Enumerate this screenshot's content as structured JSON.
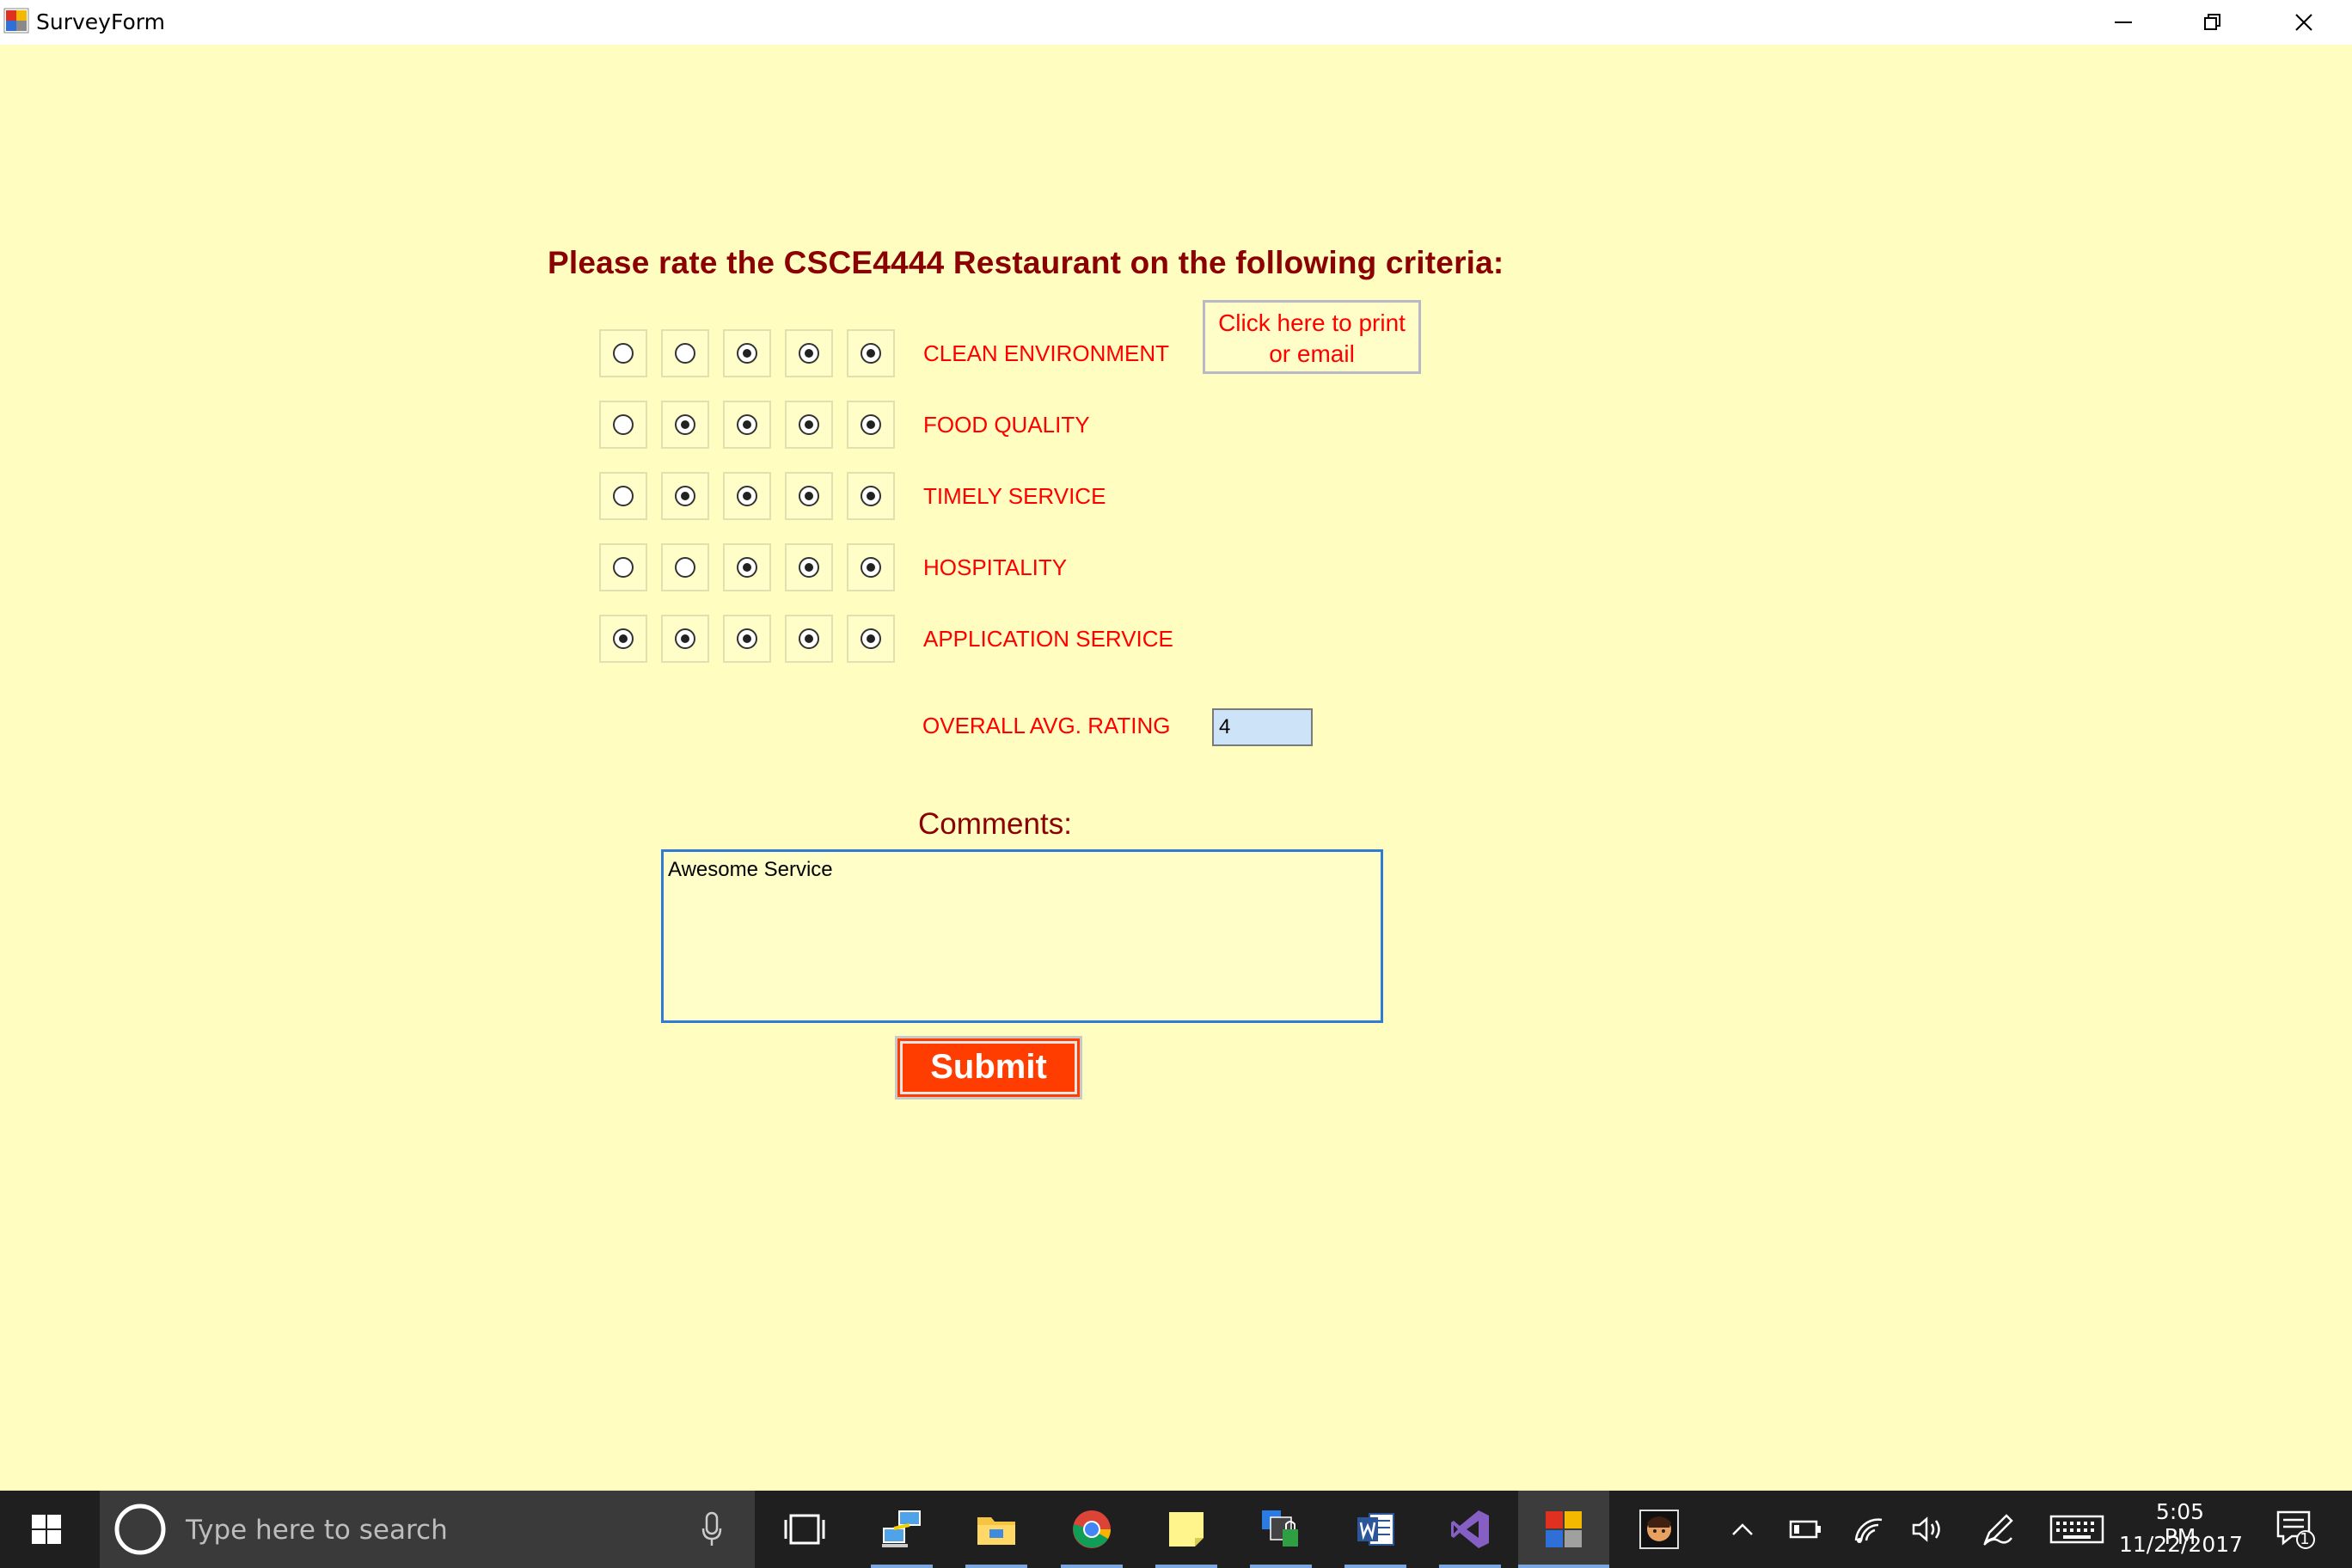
{
  "window": {
    "title": "SurveyForm",
    "icons": [
      "app-icon",
      "minimize-icon",
      "maximize-icon",
      "close-icon"
    ]
  },
  "form": {
    "heading": "Please rate the CSCE4444 Restaurant on the following criteria:",
    "print_button": "Click here to print or email",
    "criteria": [
      {
        "label": "CLEAN ENVIRONMENT",
        "rating": [
          false,
          false,
          true,
          true,
          true
        ]
      },
      {
        "label": "FOOD QUALITY",
        "rating": [
          false,
          true,
          true,
          true,
          true
        ]
      },
      {
        "label": "TIMELY SERVICE",
        "rating": [
          false,
          true,
          true,
          true,
          true
        ]
      },
      {
        "label": "HOSPITALITY",
        "rating": [
          false,
          false,
          true,
          true,
          true
        ]
      },
      {
        "label": "APPLICATION SERVICE",
        "rating": [
          true,
          true,
          true,
          true,
          true
        ]
      }
    ],
    "overall_label": "OVERALL AVG. RATING",
    "overall_value": "4",
    "comments_label": "Comments:",
    "comments_value": "Awesome Service",
    "submit_label": "Submit"
  },
  "taskbar": {
    "search_placeholder": "Type here to search",
    "time": "5:05 PM",
    "date": "11/22/2017",
    "notification_count": "1",
    "colors": {
      "background": "#1F1F1F",
      "accent": "#7AA7E0"
    }
  },
  "colors": {
    "background": "#FFFEC0",
    "heading": "#8B0000",
    "label": "#FF0000",
    "submit": "#FF3D00",
    "input": "#CDE3F7"
  }
}
